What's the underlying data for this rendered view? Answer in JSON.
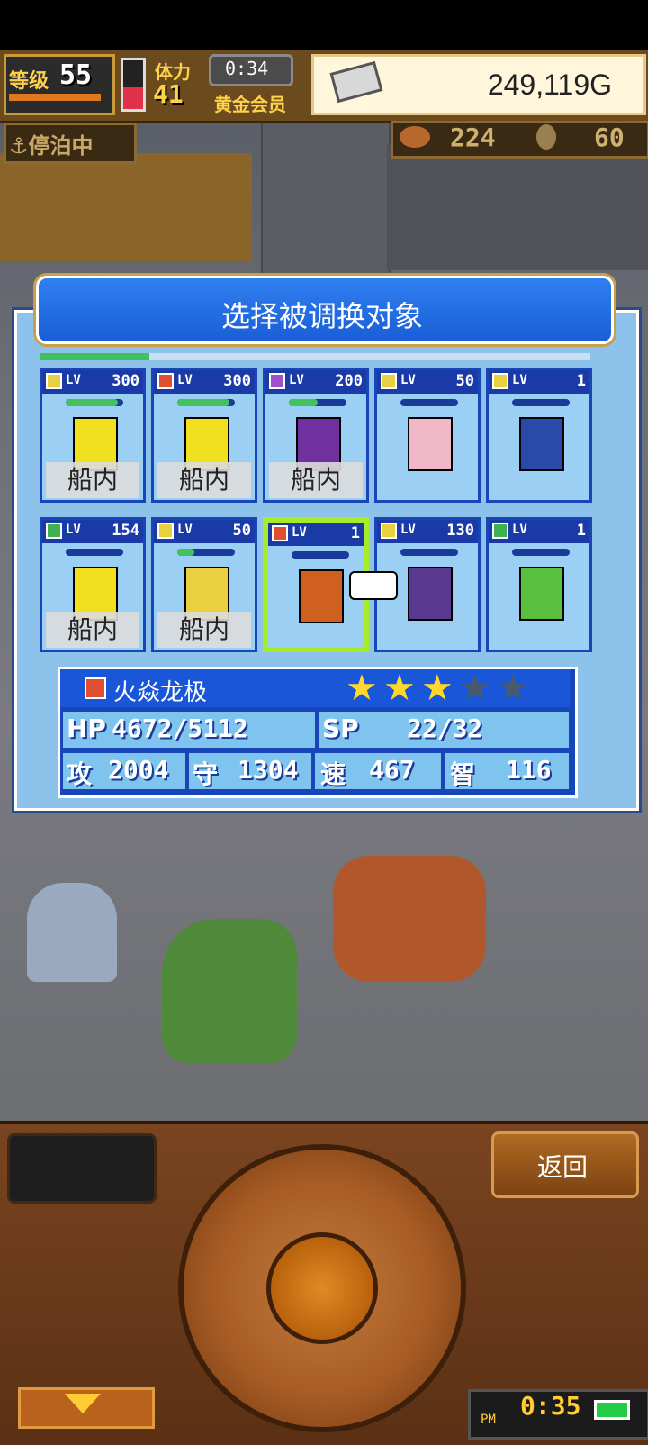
{
  "hud": {
    "level_label": "等级",
    "level": "55",
    "stamina_label": "体力",
    "stamina": "41",
    "stamina_fraction": 0.45,
    "timer": "0:34",
    "membership": "黄金会员",
    "gold": "249,119G",
    "harbor_status": "停泊中",
    "food": "224",
    "medals": "60"
  },
  "dialog": {
    "title": "选择被调换对象",
    "header_progress": 0.2
  },
  "monsters": [
    {
      "lv_label": "LV",
      "level": "300",
      "element": "thunder",
      "hp_fraction": 0.9,
      "location": "船内"
    },
    {
      "lv_label": "LV",
      "level": "300",
      "element": "fire",
      "hp_fraction": 0.9,
      "location": "船内"
    },
    {
      "lv_label": "LV",
      "level": "200",
      "element": "dark",
      "hp_fraction": 0.5,
      "location": "船内"
    },
    {
      "lv_label": "LV",
      "level": "50",
      "element": "thunder",
      "hp_fraction": 0.0,
      "location": ""
    },
    {
      "lv_label": "LV",
      "level": "1",
      "element": "thunder",
      "hp_fraction": 0.0,
      "location": ""
    },
    {
      "lv_label": "LV",
      "level": "154",
      "element": "wind",
      "hp_fraction": 0.0,
      "location": "船内"
    },
    {
      "lv_label": "LV",
      "level": "50",
      "element": "thunder",
      "hp_fraction": 0.3,
      "location": "船内"
    },
    {
      "lv_label": "LV",
      "level": "1",
      "element": "fire",
      "hp_fraction": 0.0,
      "location": "",
      "selected": true
    },
    {
      "lv_label": "LV",
      "level": "130",
      "element": "thunder",
      "hp_fraction": 0.0,
      "location": ""
    },
    {
      "lv_label": "LV",
      "level": "1",
      "element": "wind",
      "hp_fraction": 0.0,
      "location": ""
    }
  ],
  "detail": {
    "name": "火焱龙极",
    "element": "fire",
    "stars_filled": 3,
    "stars_total": 5,
    "hp_label": "HP",
    "hp": "4672/5112",
    "sp_label": "SP",
    "sp": "22/32",
    "atk_label": "攻",
    "atk": "2004",
    "def_label": "守",
    "def": "1304",
    "spd_label": "速",
    "spd": "467",
    "int_label": "智",
    "int": "116"
  },
  "controls": {
    "back_label": "返回"
  },
  "clock": {
    "ampm": "PM",
    "time": "0:35"
  },
  "colors": {
    "thunder": "#e8d040",
    "fire": "#e05030",
    "dark": "#a050c8",
    "wind": "#40b050"
  }
}
